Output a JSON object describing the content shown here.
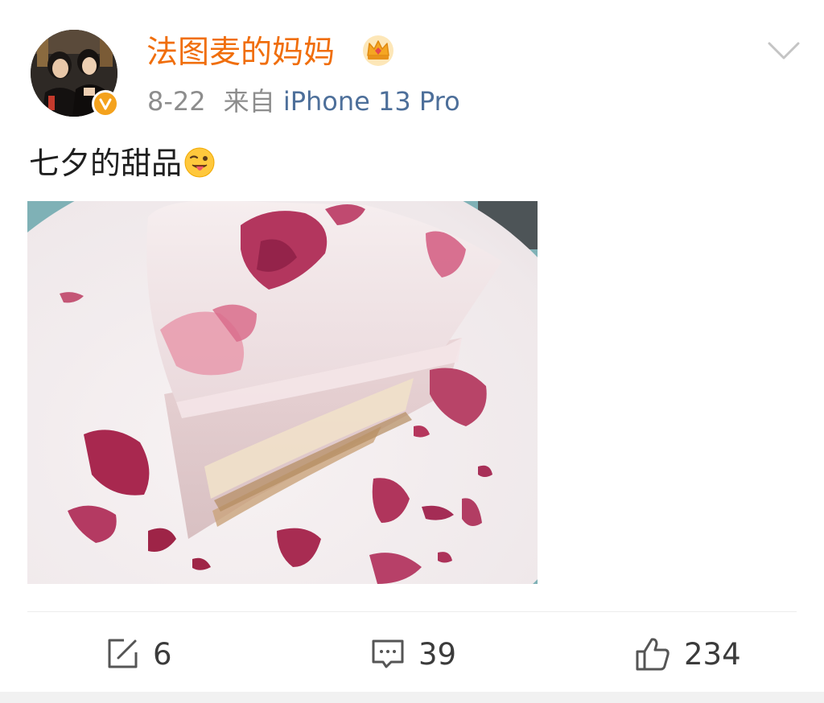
{
  "post": {
    "author": {
      "name": "法图麦的妈妈",
      "verified": true,
      "badge_color": "#f4a21d",
      "name_color": "#f06e0c"
    },
    "date": "8-22",
    "source_prefix": "来自",
    "source_device": "iPhone 13 Pro",
    "text": "七夕的甜品",
    "emoji_icon": "tongue-wink-emoji",
    "photo_description_icon": "rose-petal-cake-photo",
    "actions": {
      "repost_count": "6",
      "comment_count": "39",
      "like_count": "234"
    }
  }
}
